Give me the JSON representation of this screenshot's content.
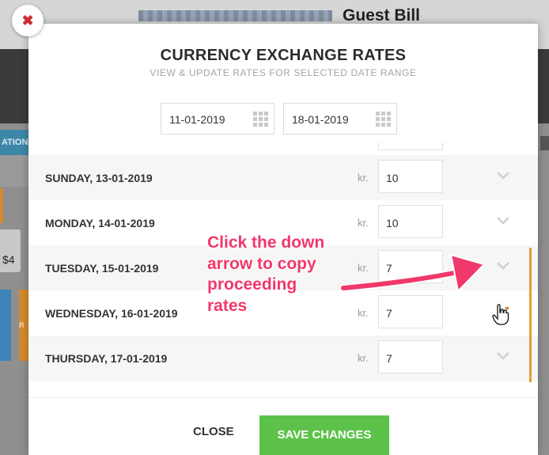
{
  "background": {
    "app_title": "Guest Bill",
    "tab_label": "ATION",
    "card_amount": "$4",
    "side_letter": "R"
  },
  "modal": {
    "close_icon": "close-x-icon",
    "title": "CURRENCY EXCHANGE RATES",
    "subtitle": "VIEW & UPDATE RATES FOR SELECTED DATE RANGE",
    "date_from": "11-01-2019",
    "date_to": "18-01-2019",
    "rows": [
      {
        "day": "SUNDAY, 13-01-2019",
        "currency": "kr.",
        "rate": "10"
      },
      {
        "day": "MONDAY, 14-01-2019",
        "currency": "kr.",
        "rate": "10"
      },
      {
        "day": "TUESDAY, 15-01-2019",
        "currency": "kr.",
        "rate": "7"
      },
      {
        "day": "WEDNESDAY, 16-01-2019",
        "currency": "kr.",
        "rate": "7"
      },
      {
        "day": "THURSDAY, 17-01-2019",
        "currency": "kr.",
        "rate": "7"
      }
    ],
    "close_label": "CLOSE",
    "save_label": "SAVE CHANGES"
  },
  "annotation": {
    "lines": [
      "Click the down",
      "arrow to copy",
      "proceeding",
      "rates"
    ]
  },
  "colors": {
    "accent_red": "#cc2b32",
    "save_green": "#5cc24a",
    "annotation_pink": "#f0386a",
    "scrollbar_orange": "#e0a030"
  }
}
